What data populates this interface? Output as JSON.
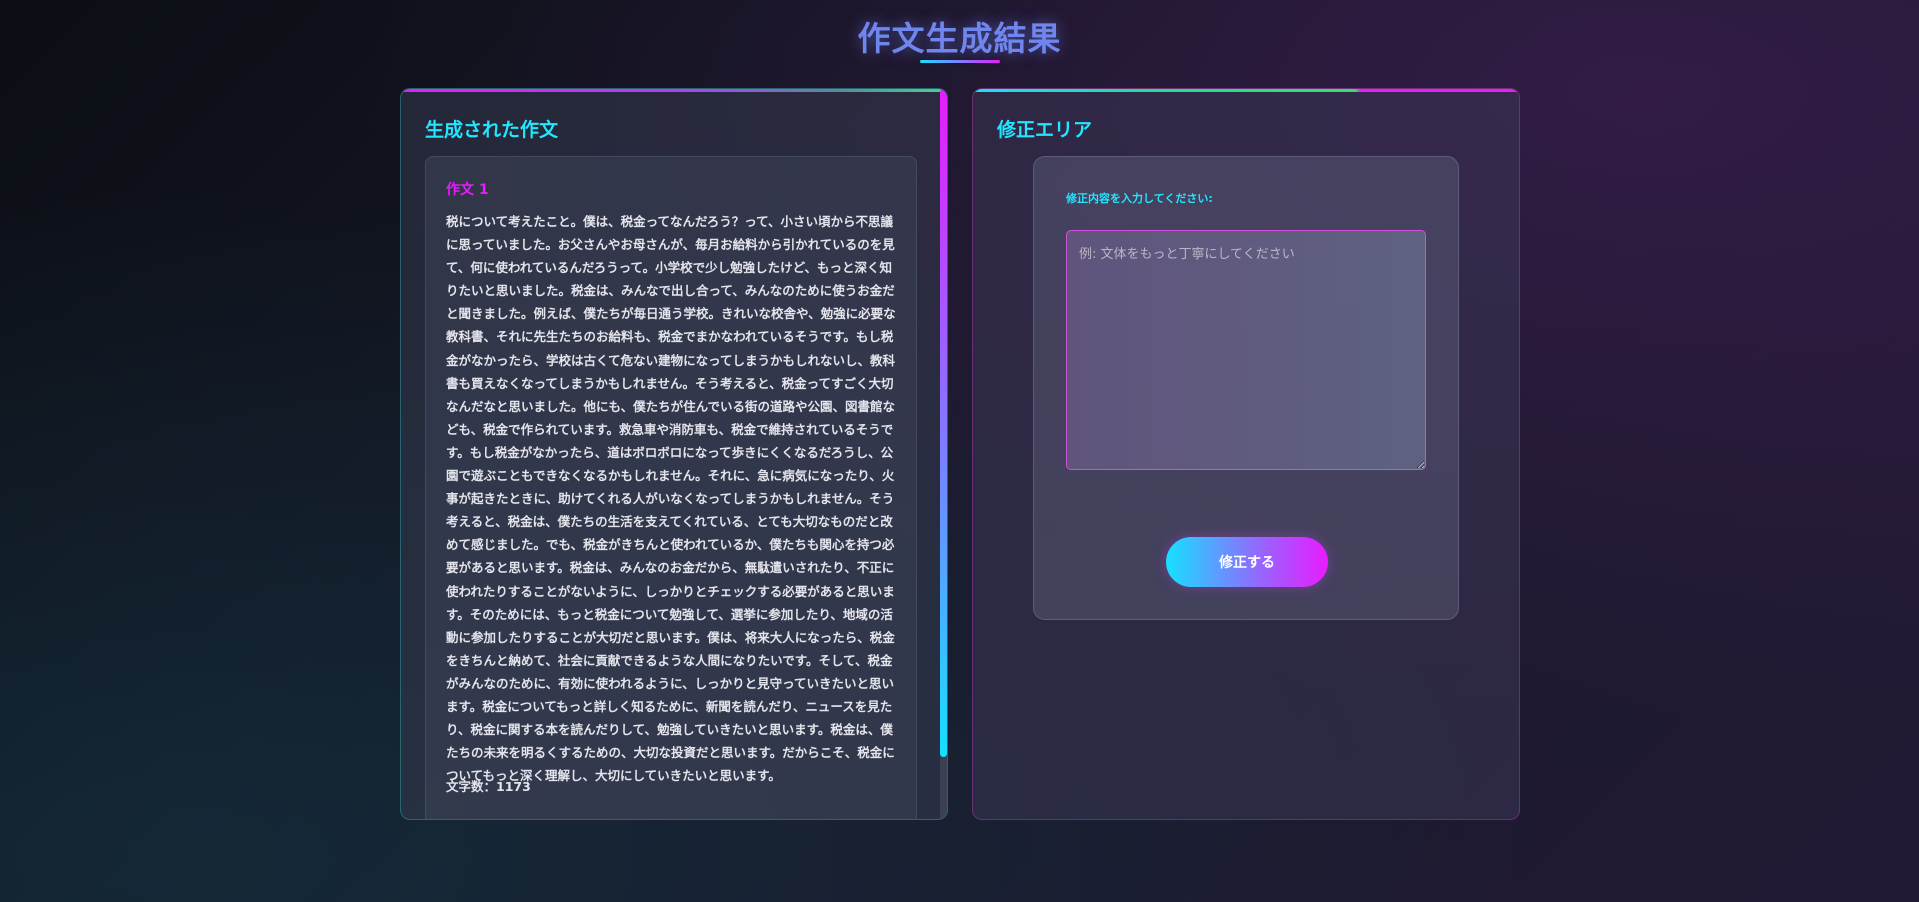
{
  "page": {
    "title": "作文生成結果"
  },
  "left_panel": {
    "heading": "生成された作文",
    "essay": {
      "title": "作文 1",
      "body": "税について考えたこと。僕は、税金ってなんだろう？って、小さい頃から不思議に思っていました。お父さんやお母さんが、毎月お給料から引かれているのを見て、何に使われているんだろうって。小学校で少し勉強したけど、もっと深く知りたいと思いました。税金は、みんなで出し合って、みんなのために使うお金だと聞きました。例えば、僕たちが毎日通う学校。きれいな校舎や、勉強に必要な教科書、それに先生たちのお給料も、税金でまかなわれているそうです。もし税金がなかったら、学校は古くて危ない建物になってしまうかもしれないし、教科書も買えなくなってしまうかもしれません。そう考えると、税金ってすごく大切なんだなと思いました。他にも、僕たちが住んでいる街の道路や公園、図書館なども、税金で作られています。救急車や消防車も、税金で維持されているそうです。もし税金がなかったら、道はボロボロになって歩きにくくなるだろうし、公園で遊ぶこともできなくなるかもしれません。それに、急に病気になったり、火事が起きたときに、助けてくれる人がいなくなってしまうかもしれません。そう考えると、税金は、僕たちの生活を支えてくれている、とても大切なものだと改めて感じました。でも、税金がきちんと使われているか、僕たちも関心を持つ必要があると思います。税金は、みんなのお金だから、無駄遣いされたり、不正に使われたりすることがないように、しっかりとチェックする必要があると思います。そのためには、もっと税金について勉強して、選挙に参加したり、地域の活動に参加したりすることが大切だと思います。僕は、将来大人になったら、税金をきちんと納めて、社会に貢献できるような人間になりたいです。そして、税金がみんなのために、有効に使われるように、しっかりと見守っていきたいと思います。税金についてもっと詳しく知るために、新聞を読んだり、ニュースを見たり、税金に関する本を読んだりして、勉強していきたいと思います。税金は、僕たちの未来を明るくするための、大切な投資だと思います。だからこそ、税金についてもっと深く理解し、大切にしていきたいと思います。",
      "char_count": "文字数：1173"
    }
  },
  "right_panel": {
    "heading": "修正エリア",
    "form": {
      "label": "修正内容を入力してください:",
      "placeholder": "例: 文体をもっと丁寧にしてください",
      "value": "",
      "submit_label": "修正する"
    }
  },
  "colors": {
    "accent_cyan": "#22e6ff",
    "accent_magenta": "#e81cff",
    "title_blue": "#6f86ee"
  }
}
